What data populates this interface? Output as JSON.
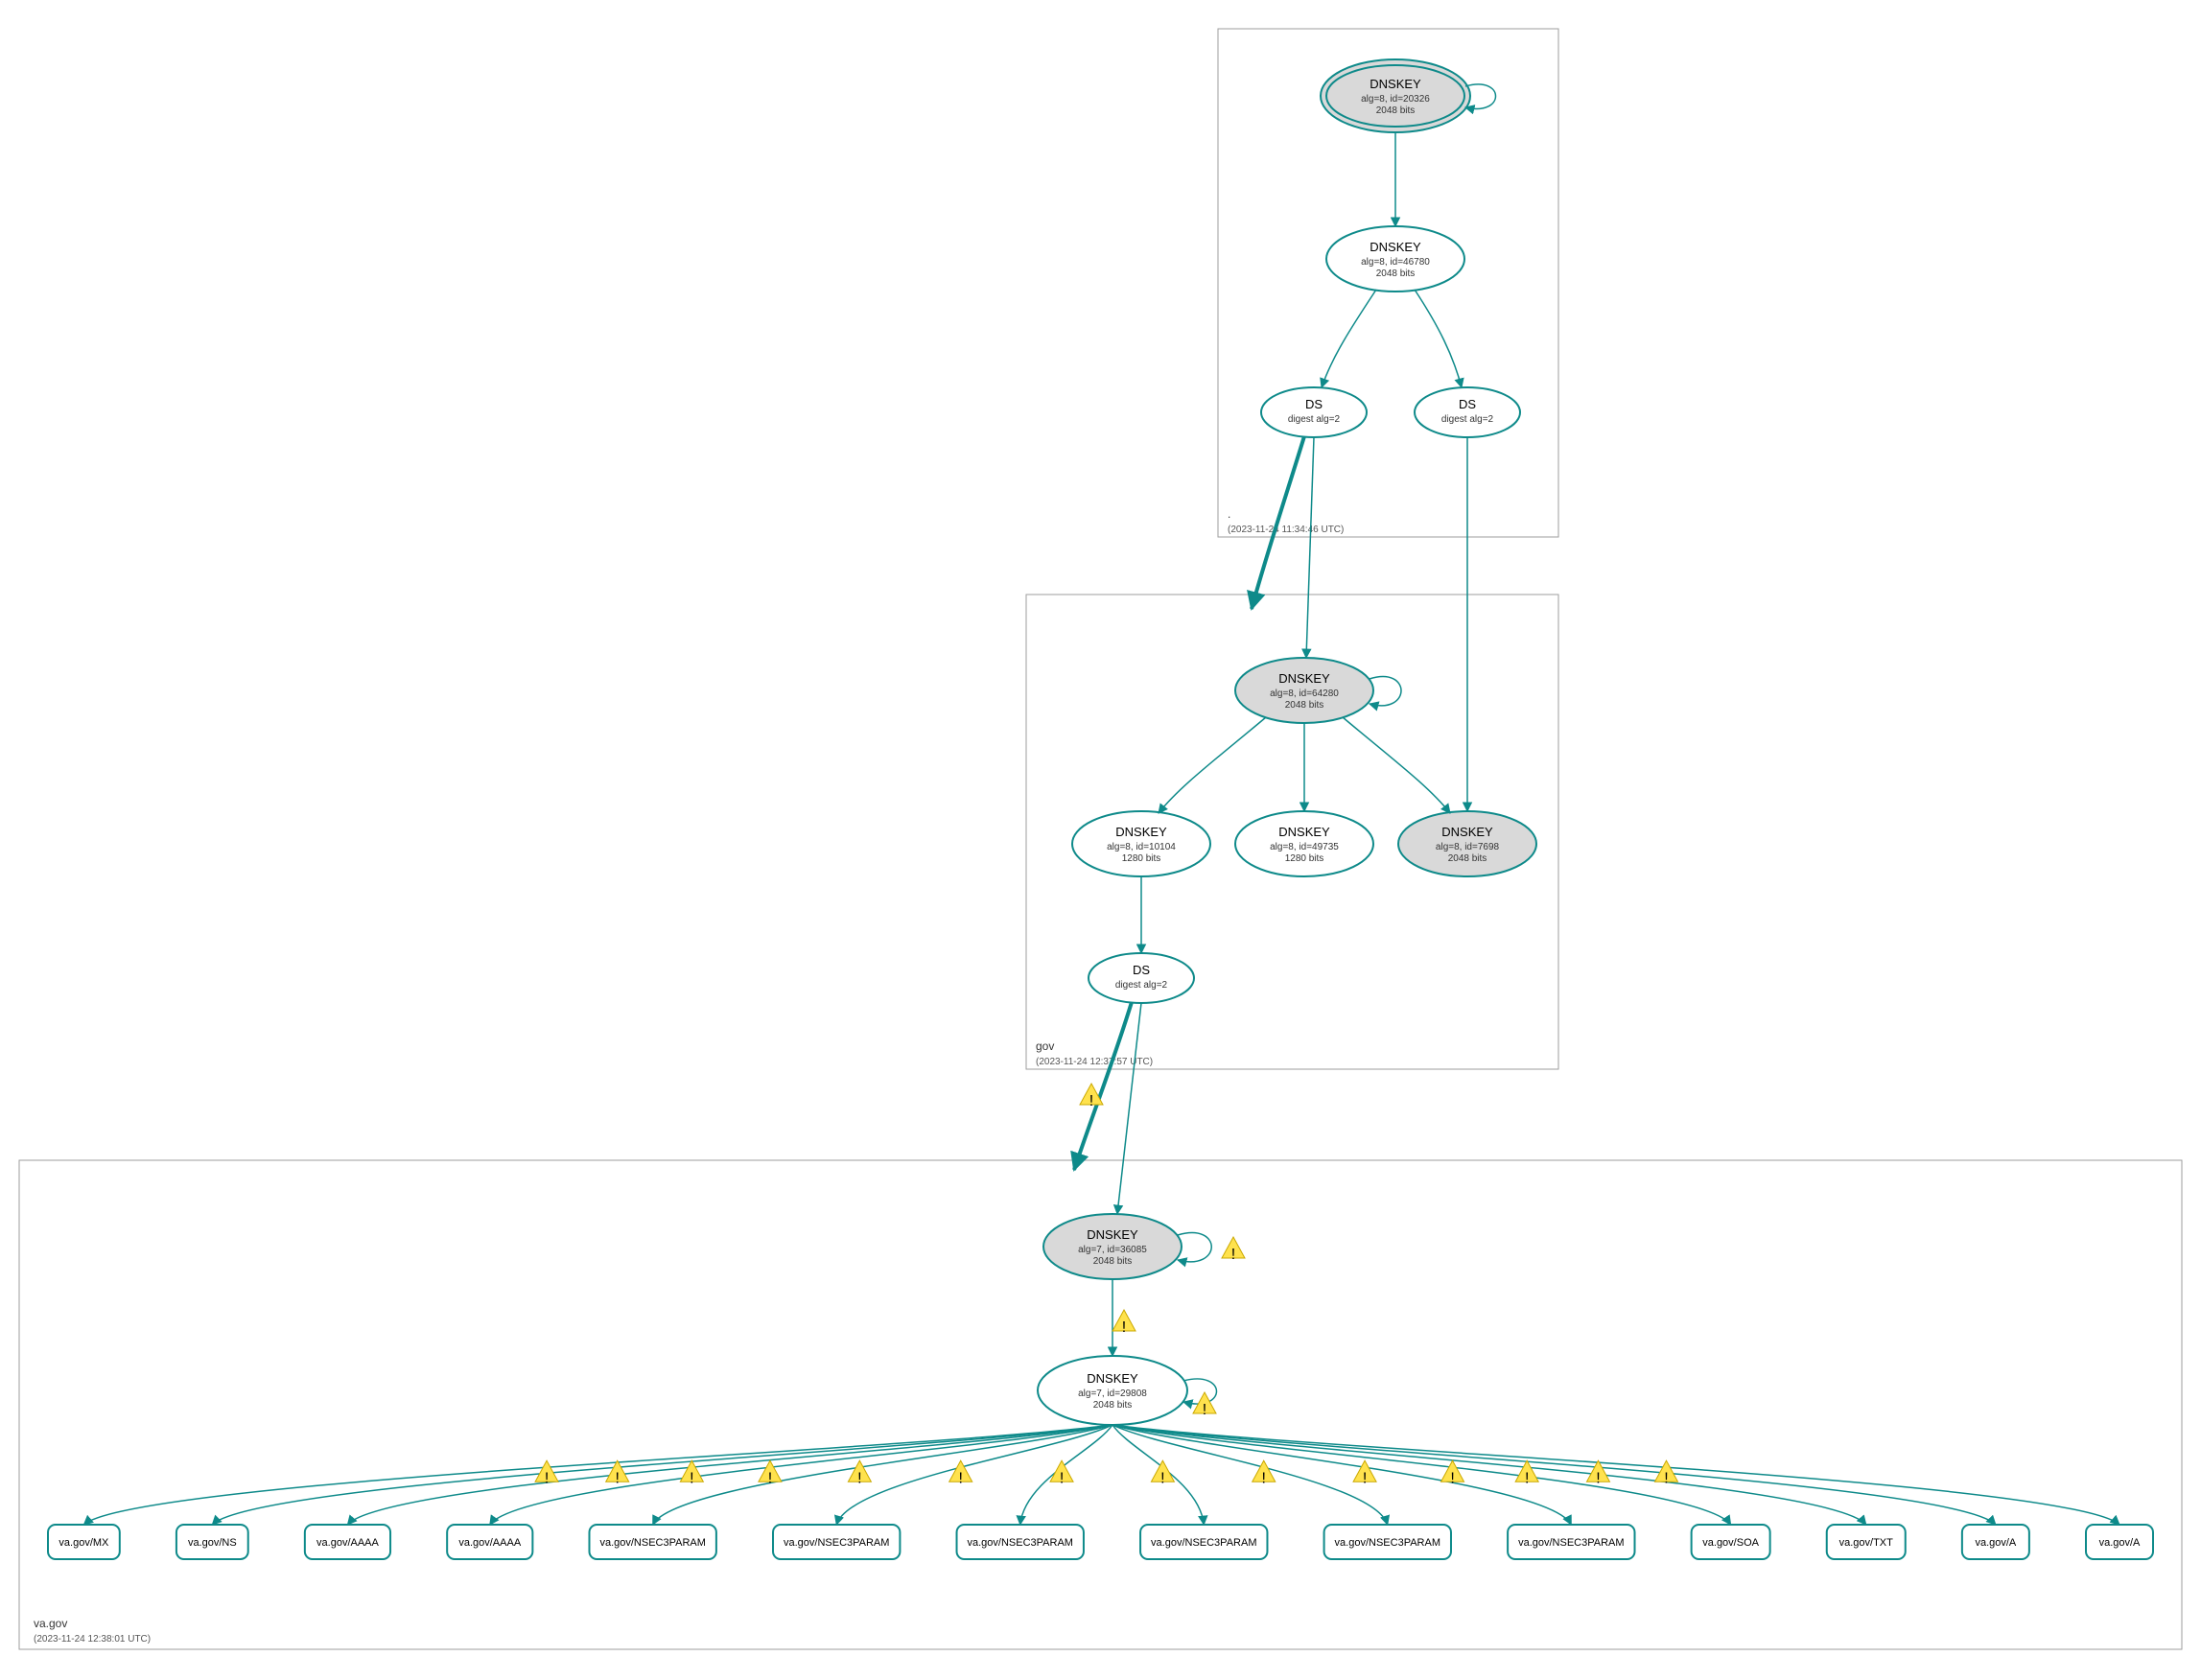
{
  "colors": {
    "teal": "#0e8a8a",
    "gray_fill": "#d9d9d9",
    "box_stroke": "#9e9e9e"
  },
  "zones": {
    "root": {
      "name": ".",
      "timestamp": "(2023-11-24 11:34:46 UTC)"
    },
    "gov": {
      "name": "gov",
      "timestamp": "(2023-11-24 12:37:57 UTC)"
    },
    "va": {
      "name": "va.gov",
      "timestamp": "(2023-11-24 12:38:01 UTC)"
    }
  },
  "nodes": {
    "root_ksk": {
      "title": "DNSKEY",
      "line2": "alg=8, id=20326",
      "line3": "2048 bits"
    },
    "root_zsk": {
      "title": "DNSKEY",
      "line2": "alg=8, id=46780",
      "line3": "2048 bits"
    },
    "root_ds1": {
      "title": "DS",
      "line2": "digest alg=2"
    },
    "root_ds2": {
      "title": "DS",
      "line2": "digest alg=2"
    },
    "gov_ksk": {
      "title": "DNSKEY",
      "line2": "alg=8, id=64280",
      "line3": "2048 bits"
    },
    "gov_zsk1": {
      "title": "DNSKEY",
      "line2": "alg=8, id=10104",
      "line3": "1280 bits"
    },
    "gov_zsk2": {
      "title": "DNSKEY",
      "line2": "alg=8, id=49735",
      "line3": "1280 bits"
    },
    "gov_zsk3": {
      "title": "DNSKEY",
      "line2": "alg=8, id=7698",
      "line3": "2048 bits"
    },
    "gov_ds": {
      "title": "DS",
      "line2": "digest alg=2"
    },
    "va_ksk": {
      "title": "DNSKEY",
      "line2": "alg=7, id=36085",
      "line3": "2048 bits"
    },
    "va_zsk": {
      "title": "DNSKEY",
      "line2": "alg=7, id=29808",
      "line3": "2048 bits"
    }
  },
  "rrsets": [
    "va.gov/MX",
    "va.gov/NS",
    "va.gov/AAAA",
    "va.gov/AAAA",
    "va.gov/NSEC3PARAM",
    "va.gov/NSEC3PARAM",
    "va.gov/NSEC3PARAM",
    "va.gov/NSEC3PARAM",
    "va.gov/NSEC3PARAM",
    "va.gov/NSEC3PARAM",
    "va.gov/SOA",
    "va.gov/TXT",
    "va.gov/A",
    "va.gov/A"
  ],
  "warn_icon": "⚠"
}
